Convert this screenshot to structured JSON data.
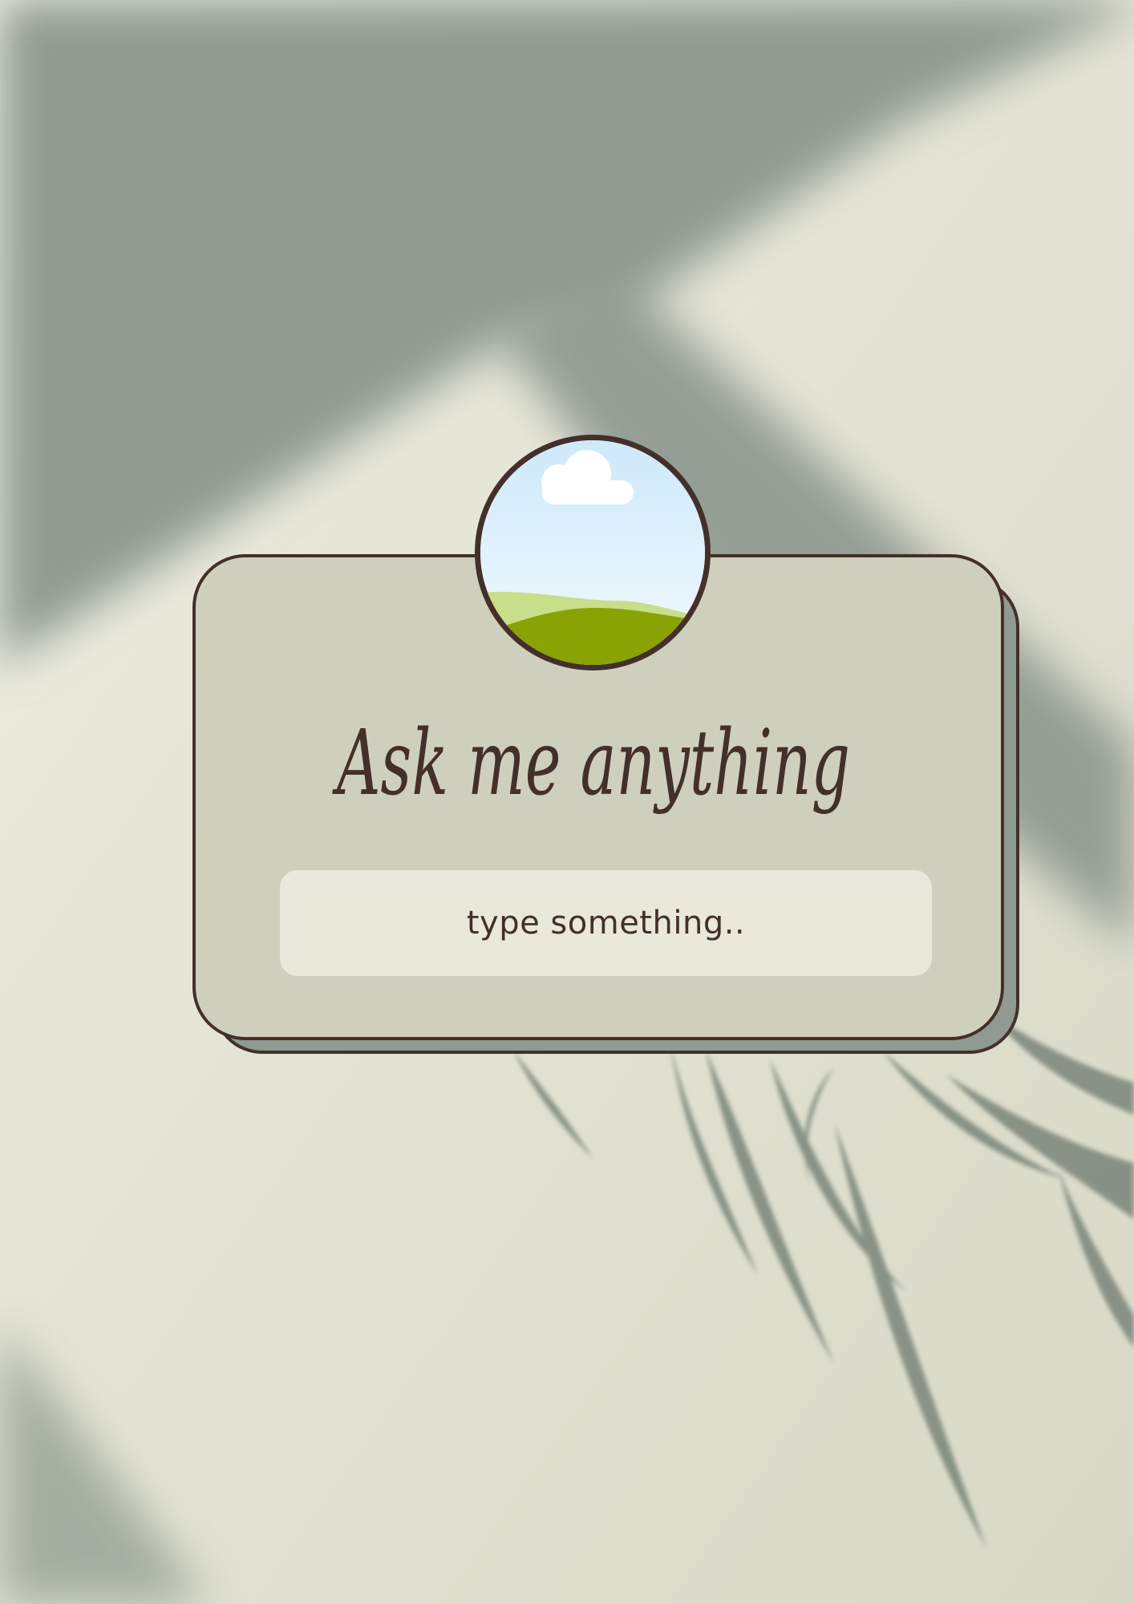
{
  "prompt_card": {
    "heading": "Ask me anything",
    "input_placeholder": "type something.."
  },
  "icons": {
    "avatar": "landscape-icon"
  },
  "colors": {
    "background": "#dcdccb",
    "card_fill": "#cfcfbe",
    "card_shadow": "#8f9a90",
    "outline": "#43302a",
    "input_fill": "#e9e8da",
    "text": "#43302a"
  }
}
